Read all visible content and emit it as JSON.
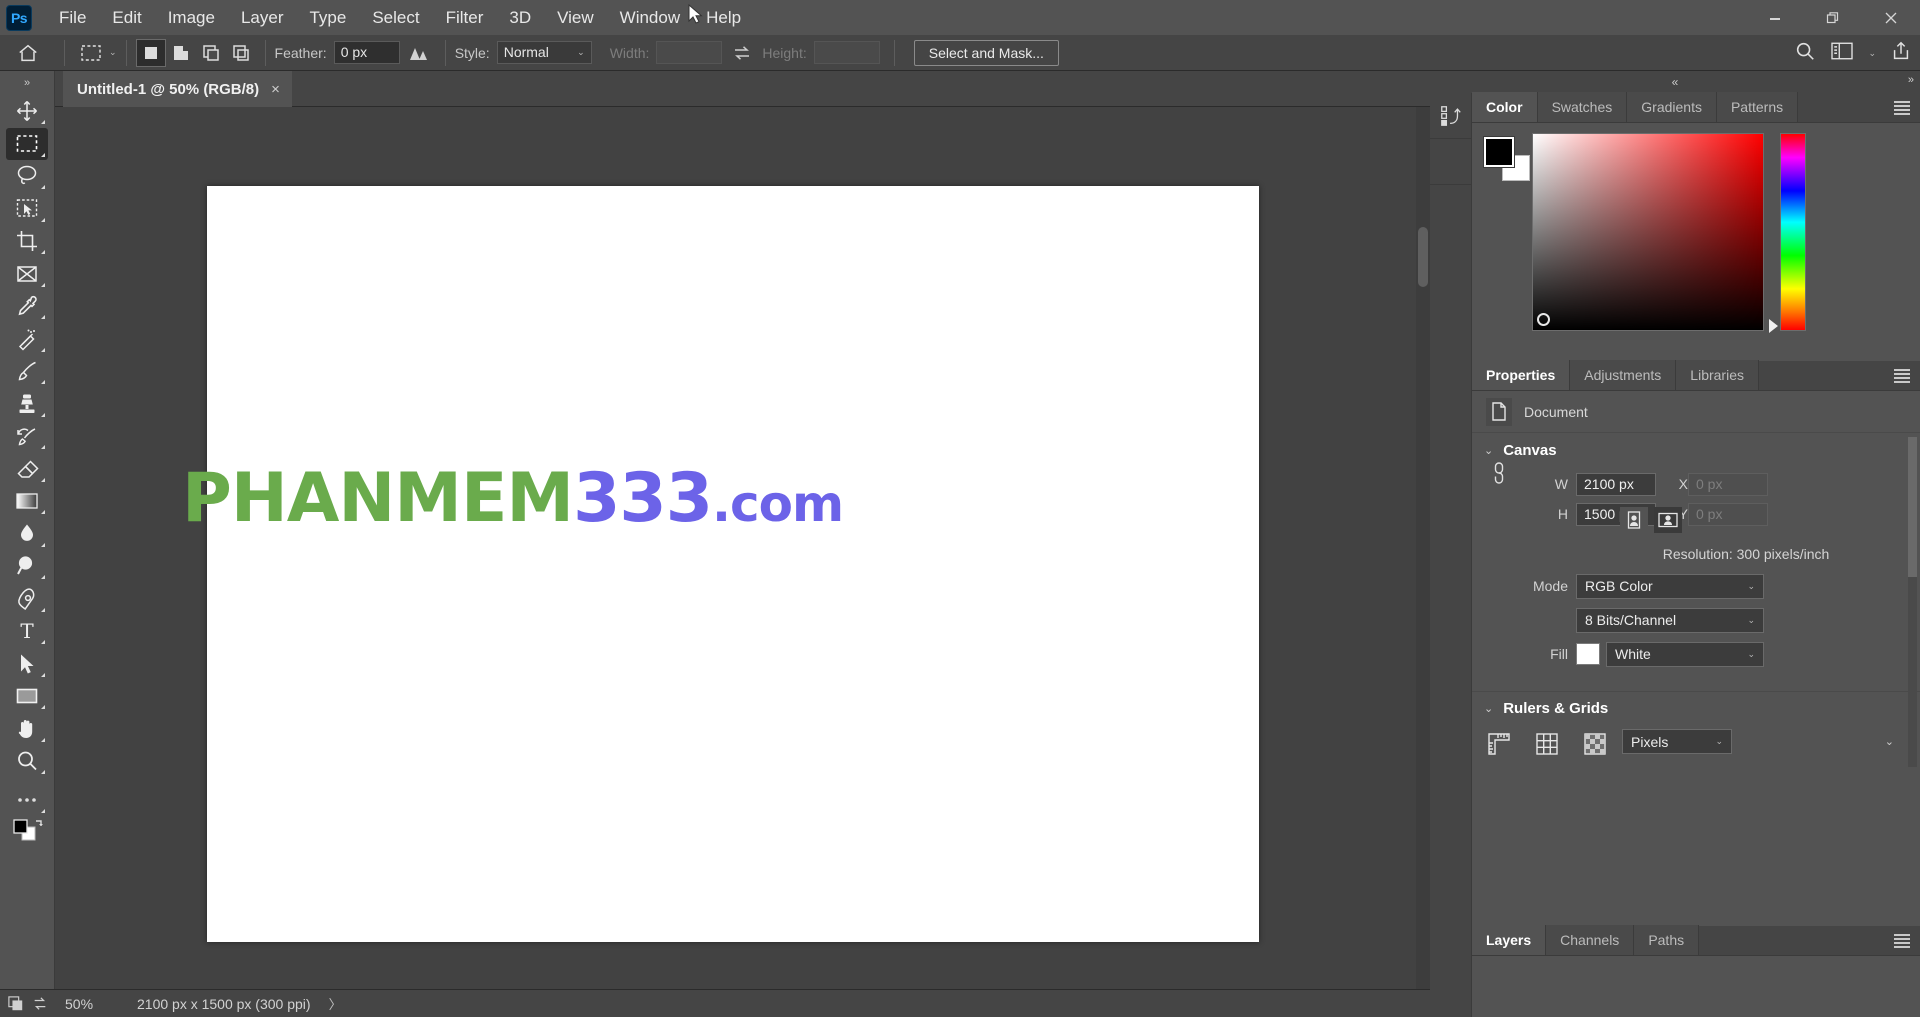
{
  "app": {
    "name": "Adobe Photoshop",
    "logo_text": "Ps"
  },
  "menubar": {
    "items": [
      {
        "label": "File"
      },
      {
        "label": "Edit"
      },
      {
        "label": "Image"
      },
      {
        "label": "Layer"
      },
      {
        "label": "Type"
      },
      {
        "label": "Select"
      },
      {
        "label": "Filter"
      },
      {
        "label": "3D"
      },
      {
        "label": "View"
      },
      {
        "label": "Window"
      },
      {
        "label": "Help"
      }
    ],
    "window_controls": [
      {
        "name": "minimize",
        "glyph": "—"
      },
      {
        "name": "restore",
        "glyph": "❐"
      },
      {
        "name": "close",
        "glyph": "✕"
      }
    ]
  },
  "options_bar": {
    "home_icon": "home-icon",
    "tool_preset": "rectangular-marquee-icon",
    "preset_caret": "⌄",
    "selection_modes": [
      {
        "name": "new-selection",
        "active": true
      },
      {
        "name": "add-to-selection",
        "active": false
      },
      {
        "name": "subtract-from-selection",
        "active": false
      },
      {
        "name": "intersect-with-selection",
        "active": false
      }
    ],
    "feather_label": "Feather:",
    "feather_value": "0 px",
    "antialias_icon": "anti-alias-icon",
    "style_label": "Style:",
    "style_value": "Normal",
    "width_label": "Width:",
    "width_value": "",
    "swap_icon": "swap-dimensions-icon",
    "height_label": "Height:",
    "height_value": "",
    "select_and_mask_label": "Select and Mask...",
    "right_icons": [
      {
        "name": "search-icon"
      },
      {
        "name": "workspace-icon"
      },
      {
        "name": "chevron-down-icon"
      },
      {
        "name": "share-icon"
      }
    ]
  },
  "toolbar": {
    "collapse_glyph": "»",
    "tools": [
      {
        "name": "move-tool",
        "active": false
      },
      {
        "name": "rectangular-marquee-tool",
        "active": true
      },
      {
        "name": "lasso-tool",
        "active": false
      },
      {
        "name": "object-selection-tool",
        "active": false
      },
      {
        "name": "crop-tool",
        "active": false
      },
      {
        "name": "frame-tool",
        "active": false
      },
      {
        "name": "eyedropper-tool",
        "active": false
      },
      {
        "name": "spot-healing-brush-tool",
        "active": false
      },
      {
        "name": "brush-tool",
        "active": false
      },
      {
        "name": "clone-stamp-tool",
        "active": false
      },
      {
        "name": "history-brush-tool",
        "active": false
      },
      {
        "name": "eraser-tool",
        "active": false
      },
      {
        "name": "gradient-tool",
        "active": false
      },
      {
        "name": "blur-tool",
        "active": false
      },
      {
        "name": "dodge-tool",
        "active": false
      },
      {
        "name": "pen-tool",
        "active": false
      },
      {
        "name": "type-tool",
        "active": false
      },
      {
        "name": "path-selection-tool",
        "active": false
      },
      {
        "name": "rectangle-tool",
        "active": false
      },
      {
        "name": "hand-tool",
        "active": false
      },
      {
        "name": "zoom-tool",
        "active": false
      },
      {
        "name": "edit-toolbar-tool",
        "active": false
      }
    ],
    "foreground_color": "#000000",
    "background_color": "#ffffff"
  },
  "document": {
    "tab_title": "Untitled-1 @ 50% (RGB/8)",
    "close_glyph": "×",
    "watermark": {
      "part1": "PHANMEM",
      "part1_color": "#6aab4c",
      "part2": "333",
      "part2_color": "#6c63e8",
      "part3": ".com",
      "part3_color": "#6c63e8"
    }
  },
  "statusbar": {
    "zoom": "50%",
    "doc_size": "2100 px x 1500 px (300 ppi)",
    "expand_glyph": "〉"
  },
  "right_dock": {
    "collapse_glyph": "«",
    "expand_glyph": "»",
    "rail_icons": [
      {
        "name": "history-icon"
      },
      {
        "name": "panel-placeholder-icon"
      }
    ],
    "color_panel": {
      "tabs": [
        {
          "label": "Color",
          "active": true
        },
        {
          "label": "Swatches",
          "active": false
        },
        {
          "label": "Gradients",
          "active": false
        },
        {
          "label": "Patterns",
          "active": false
        }
      ],
      "menu_icon": "panel-menu-icon",
      "foreground_color": "#000000",
      "background_color": "#ffffff",
      "hue": "red"
    },
    "properties_panel": {
      "tabs": [
        {
          "label": "Properties",
          "active": true
        },
        {
          "label": "Adjustments",
          "active": false
        },
        {
          "label": "Libraries",
          "active": false
        }
      ],
      "menu_icon": "panel-menu-icon",
      "doc_icon": "document-icon",
      "doc_label": "Document",
      "canvas_section": {
        "title": "Canvas",
        "chevron": "⌄",
        "link_icon": "link-dimensions-icon",
        "w_label": "W",
        "w_value": "2100 px",
        "h_label": "H",
        "h_value": "1500 px",
        "x_label": "X",
        "x_placeholder": "0 px",
        "y_label": "Y",
        "y_placeholder": "0 px",
        "orientation": [
          {
            "name": "portrait-orientation",
            "active": false
          },
          {
            "name": "landscape-orientation",
            "active": true
          }
        ],
        "resolution_text": "Resolution: 300 pixels/inch",
        "mode_label": "Mode",
        "mode_value": "RGB Color",
        "depth_value": "8 Bits/Channel",
        "fill_label": "Fill",
        "fill_color": "#ffffff",
        "fill_value": "White"
      },
      "rulers_section": {
        "title": "Rulers & Grids",
        "chevron": "⌄",
        "icons": [
          {
            "name": "rulers-icon"
          },
          {
            "name": "grid-icon"
          },
          {
            "name": "transparency-grid-icon"
          }
        ],
        "unit_value": "Pixels",
        "more_glyph": "⌄"
      }
    },
    "layers_panel": {
      "tabs": [
        {
          "label": "Layers",
          "active": true
        },
        {
          "label": "Channels",
          "active": false
        },
        {
          "label": "Paths",
          "active": false
        }
      ],
      "menu_icon": "panel-menu-icon"
    }
  }
}
